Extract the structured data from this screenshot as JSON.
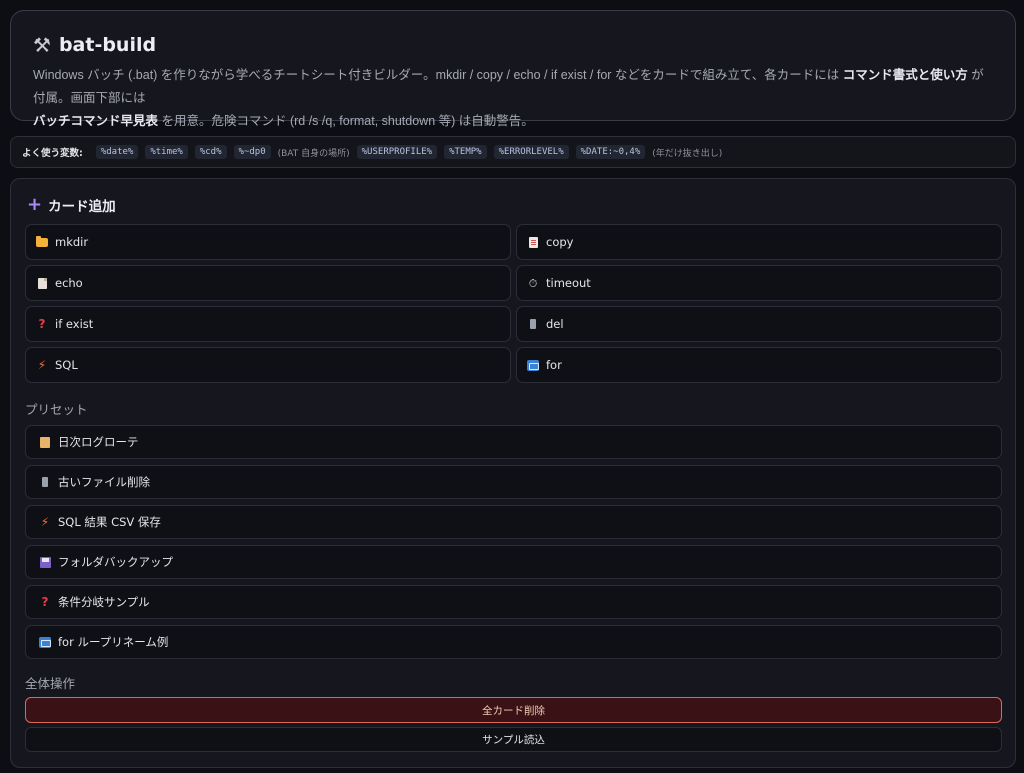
{
  "header": {
    "title": "bat-build",
    "desc_line1_a": "Windows バッチ (.bat) を作りながら学べるチートシート付きビルダー。mkdir / copy / echo / if exist / for などをカードで組み立て、各カードには ",
    "desc_line1_bold": "コマンド書式と使い方",
    "desc_line1_b": " が付属。画面下部には",
    "desc_line2_bold": "バッチコマンド早見表",
    "desc_line2_b": " を用意。危険コマンド (rd /s /q, format, shutdown 等) は自動警告。"
  },
  "vars": {
    "label": "よく使う変数:",
    "chips": [
      "%date%",
      "%time%",
      "%cd%",
      "%~dp0"
    ],
    "note1": "(BAT 自身の場所)",
    "chips2": [
      "%USERPROFILE%",
      "%TEMP%",
      "%ERRORLEVEL%",
      "%DATE:~0,4%"
    ],
    "note2": "(年だけ抜き出し)"
  },
  "add": {
    "title": "カード追加",
    "cards": [
      {
        "label": "mkdir",
        "icon": "folder-icon"
      },
      {
        "label": "copy",
        "icon": "clipboard-icon"
      },
      {
        "label": "echo",
        "icon": "page-icon"
      },
      {
        "label": "timeout",
        "icon": "timer-icon"
      },
      {
        "label": "if exist",
        "icon": "question-icon"
      },
      {
        "label": "del",
        "icon": "trash-icon"
      },
      {
        "label": "SQL",
        "icon": "bolt-icon"
      },
      {
        "label": "for",
        "icon": "loop-icon"
      }
    ]
  },
  "presets": {
    "title": "プリセット",
    "items": [
      {
        "label": "日次ログローテ",
        "icon": "scroll-icon"
      },
      {
        "label": "古いファイル削除",
        "icon": "trash-icon"
      },
      {
        "label": "SQL 結果 CSV 保存",
        "icon": "bolt-icon"
      },
      {
        "label": "フォルダバックアップ",
        "icon": "floppy-icon"
      },
      {
        "label": "条件分岐サンプル",
        "icon": "question-icon"
      },
      {
        "label": "for ループリネーム例",
        "icon": "loop-icon"
      }
    ]
  },
  "ops": {
    "title": "全体操作",
    "clear_label": "全カード削除",
    "sample_label": "サンプル読込"
  },
  "colors": {
    "accent": "#a78bfa",
    "danger_border": "#d96a5a",
    "danger_bg": "#3a1216"
  }
}
